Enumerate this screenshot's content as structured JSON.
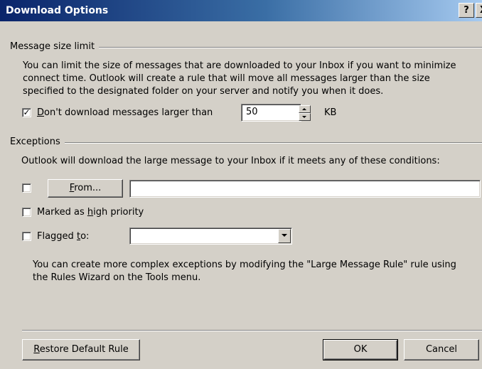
{
  "window": {
    "title": "Download Options",
    "help_label": "?",
    "close_label": "X"
  },
  "size_group": {
    "title": "Message size limit",
    "description_line1": "You can limit the size of messages that are downloaded to your Inbox if you want to minimize",
    "description_line2": "connect time. Outlook will create a rule that will move all messages larger than the size",
    "description_line3": "specified to the designated folder on your server and notify you when it does.",
    "limit_checked": true,
    "limit_mnemonic": "D",
    "limit_label_rest": "on't download messages larger than",
    "limit_value": "50",
    "limit_unit": "KB"
  },
  "exceptions_group": {
    "title": "Exceptions",
    "intro": "Outlook will download the large message to your Inbox if it meets any of these conditions:",
    "from_checked": false,
    "from_button_mnemonic": "F",
    "from_button_rest": "rom...",
    "from_value": "",
    "priority_checked": false,
    "priority_label_pre": "Marked as ",
    "priority_label_mnemonic": "h",
    "priority_label_post": "igh priority",
    "flagged_checked": false,
    "flagged_label_pre": "Flagged ",
    "flagged_label_mnemonic": "t",
    "flagged_label_post": "o:",
    "flagged_value": "",
    "footer_line1": "You can create more complex exceptions by modifying the \"Large Message Rule\" rule using",
    "footer_line2": "the Rules Wizard on the Tools menu."
  },
  "buttons": {
    "restore_mnemonic": "R",
    "restore_rest": "estore Default Rule",
    "ok": "OK",
    "cancel": "Cancel"
  }
}
